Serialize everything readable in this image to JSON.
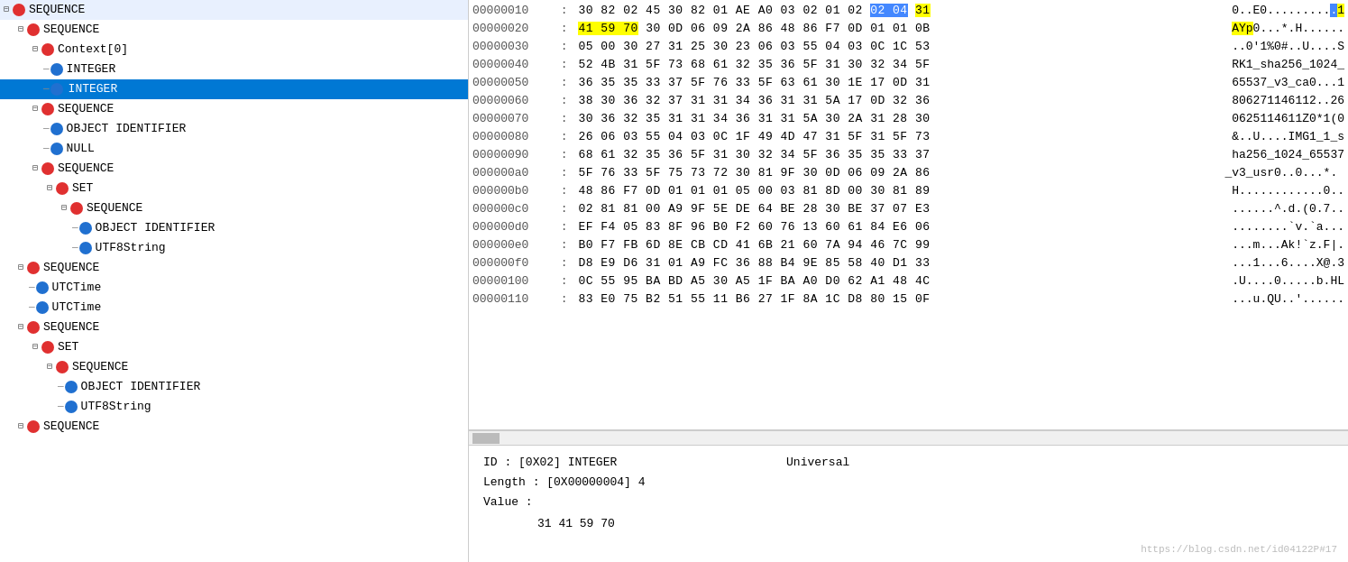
{
  "toolbar": {
    "buttons": [
      "⬅",
      "➡",
      "⬛",
      "⭮"
    ]
  },
  "tree": {
    "items": [
      {
        "id": 0,
        "indent": 0,
        "expanded": true,
        "hasExpand": true,
        "iconColor": "red",
        "label": "SEQUENCE",
        "selected": false,
        "connector": "─"
      },
      {
        "id": 1,
        "indent": 1,
        "expanded": true,
        "hasExpand": true,
        "iconColor": "red",
        "label": "SEQUENCE",
        "selected": false,
        "connector": "├─"
      },
      {
        "id": 2,
        "indent": 2,
        "expanded": true,
        "hasExpand": true,
        "iconColor": "red",
        "label": "Context[0]",
        "selected": false,
        "connector": "├─"
      },
      {
        "id": 3,
        "indent": 3,
        "expanded": false,
        "hasExpand": false,
        "iconColor": "blue",
        "label": "INTEGER",
        "selected": false,
        "connector": "├─"
      },
      {
        "id": 4,
        "indent": 3,
        "expanded": false,
        "hasExpand": false,
        "iconColor": "blue",
        "label": "INTEGER",
        "selected": true,
        "connector": "└─"
      },
      {
        "id": 5,
        "indent": 2,
        "expanded": true,
        "hasExpand": true,
        "iconColor": "red",
        "label": "SEQUENCE",
        "selected": false,
        "connector": "├─"
      },
      {
        "id": 6,
        "indent": 3,
        "expanded": false,
        "hasExpand": false,
        "iconColor": "blue",
        "label": "OBJECT IDENTIFIER",
        "selected": false,
        "connector": "├─"
      },
      {
        "id": 7,
        "indent": 3,
        "expanded": false,
        "hasExpand": false,
        "iconColor": "blue",
        "label": "NULL",
        "selected": false,
        "connector": "└─"
      },
      {
        "id": 8,
        "indent": 2,
        "expanded": true,
        "hasExpand": true,
        "iconColor": "red",
        "label": "SEQUENCE",
        "selected": false,
        "connector": "└─"
      },
      {
        "id": 9,
        "indent": 3,
        "expanded": true,
        "hasExpand": true,
        "iconColor": "red",
        "label": "SET",
        "selected": false,
        "connector": "└─"
      },
      {
        "id": 10,
        "indent": 4,
        "expanded": true,
        "hasExpand": true,
        "iconColor": "red",
        "label": "SEQUENCE",
        "selected": false,
        "connector": "└─"
      },
      {
        "id": 11,
        "indent": 5,
        "expanded": false,
        "hasExpand": false,
        "iconColor": "blue",
        "label": "OBJECT IDENTIFIER",
        "selected": false,
        "connector": "├─"
      },
      {
        "id": 12,
        "indent": 5,
        "expanded": false,
        "hasExpand": false,
        "iconColor": "blue",
        "label": "UTF8String",
        "selected": false,
        "connector": "└─"
      },
      {
        "id": 13,
        "indent": 1,
        "expanded": true,
        "hasExpand": true,
        "iconColor": "red",
        "label": "SEQUENCE",
        "selected": false,
        "connector": "├─"
      },
      {
        "id": 14,
        "indent": 2,
        "expanded": false,
        "hasExpand": false,
        "iconColor": "blue",
        "label": "UTCTime",
        "selected": false,
        "connector": "├─"
      },
      {
        "id": 15,
        "indent": 2,
        "expanded": false,
        "hasExpand": false,
        "iconColor": "blue",
        "label": "UTCTime",
        "selected": false,
        "connector": "└─"
      },
      {
        "id": 16,
        "indent": 1,
        "expanded": true,
        "hasExpand": true,
        "iconColor": "red",
        "label": "SEQUENCE",
        "selected": false,
        "connector": "├─"
      },
      {
        "id": 17,
        "indent": 2,
        "expanded": true,
        "hasExpand": true,
        "iconColor": "red",
        "label": "SET",
        "selected": false,
        "connector": "└─"
      },
      {
        "id": 18,
        "indent": 3,
        "expanded": true,
        "hasExpand": true,
        "iconColor": "red",
        "label": "SEQUENCE",
        "selected": false,
        "connector": "└─"
      },
      {
        "id": 19,
        "indent": 4,
        "expanded": false,
        "hasExpand": false,
        "iconColor": "blue",
        "label": "OBJECT IDENTIFIER",
        "selected": false,
        "connector": "├─"
      },
      {
        "id": 20,
        "indent": 4,
        "expanded": false,
        "hasExpand": false,
        "iconColor": "blue",
        "label": "UTF8String",
        "selected": false,
        "connector": "└─"
      },
      {
        "id": 21,
        "indent": 1,
        "expanded": true,
        "hasExpand": true,
        "iconColor": "red",
        "label": "SEQUENCE",
        "selected": false,
        "connector": "└─"
      }
    ]
  },
  "hex": {
    "rows": [
      {
        "addr": "00000010",
        "bytes": "30 82 02 45 30 82 01 AE A0 03 02 01 02",
        "hl": [
          {
            "byte": "02",
            "cls": "hl-blue"
          },
          {
            "byte": "04",
            "cls": "hl-blue"
          },
          {
            "byte": "31",
            "cls": "hl-yellow"
          }
        ],
        "raw_bytes": "30 82 02 45 30 82 01 AE A0 03 02 01 02 <02> <04> <31>",
        "ascii": "0..E0.........1",
        "hl_ascii_start": 13
      },
      {
        "addr": "00000020",
        "bytes": "41 59 70 30 0D 06 09 2A 86 48 86 F7 0D 01 01 0B",
        "raw_bytes": "41 59 70 ...",
        "ascii": "AYp0...*.H......",
        "hl_ascii": [
          0,
          1,
          2
        ]
      },
      {
        "addr": "00000030",
        "bytes": "05 00 30 27 31 25 30 23 06 03 55 04 03 0C 1C 53",
        "ascii": "..0'1%0#..U....S"
      },
      {
        "addr": "00000040",
        "bytes": "52 4B 31 5F 73 68 61 32 35 36 5F 31 30 32 34 5F",
        "ascii": "RK1_sha256_1024_"
      },
      {
        "addr": "00000050",
        "bytes": "36 35 35 33 37 5F 76 33 5F 63 61 30 1E 17 0D 31",
        "ascii": "65537_v3_ca0...1"
      },
      {
        "addr": "00000060",
        "bytes": "38 30 36 32 37 31 31 34 36 31 31 5A 17 0D 32 36",
        "ascii": "806271146112..26"
      },
      {
        "addr": "00000070",
        "bytes": "30 36 32 35 31 31 34 36 31 31 5A 30 2A 31 28 30",
        "ascii": "0625114611Z0*1(0"
      },
      {
        "addr": "00000080",
        "bytes": "26 06 03 55 04 03 0C 1F 49 4D 47 31 5F 31 5F 73",
        "ascii": "&..U....IMG1_1_s"
      },
      {
        "addr": "00000090",
        "bytes": "68 61 32 35 36 5F 31 30 32 34 5F 36 35 35 33 37",
        "ascii": "ha256_1024_65537"
      },
      {
        "addr": "000000a0",
        "bytes": "5F 76 33 5F 75 73 72 30 81 9F 30 0D 06 09 2A 86",
        "ascii": "_v3_usr0..0...*. "
      },
      {
        "addr": "000000b0",
        "bytes": "48 86 F7 0D 01 01 01 05 00 03 81 8D 00 30 81 89",
        "ascii": "H............0.."
      },
      {
        "addr": "000000c0",
        "bytes": "02 81 81 00 A9 9F 5E DE 64 BE 28 30 BE 37 07 E3",
        "ascii": "......^.d.(0.7.."
      },
      {
        "addr": "000000d0",
        "bytes": "EF F4 05 83 8F 96 B0 F2 60 76 13 60 61 84 E6 06",
        "ascii": "........`v.`a..."
      },
      {
        "addr": "000000e0",
        "bytes": "B0 F7 FB 6D 8E CB CD 41 6B 21 60 7A 94 46 7C 99",
        "ascii": "...m...Ak!`z.F|."
      },
      {
        "addr": "000000f0",
        "bytes": "D8 E9 D6 31 01 A9 FC 36 88 B4 9E 85 58 40 D1 33",
        "ascii": "...1...6....X@.3"
      },
      {
        "addr": "00000100",
        "bytes": "0C 55 95 BA BD A5 30 A5 1F BA A0 D0 62 A1 48 4C",
        "ascii": ".U....0.....b.HL"
      },
      {
        "addr": "00000110",
        "bytes": "83 E0 75 B2 51 55 11 B6 27 1F 8A 1C D8 80 15 0F",
        "ascii": "...u.QU..'......"
      }
    ]
  },
  "info": {
    "id_label": "ID",
    "id_value": ": [0X02] INTEGER",
    "id_extra": "Universal",
    "length_label": "Length",
    "length_value": ": [0X00000004] 4",
    "value_label": "Value",
    "value_colon": ":",
    "value_hex": "31 41 59 70"
  },
  "watermark": "https://blog.csdn.net/id04122P#17"
}
